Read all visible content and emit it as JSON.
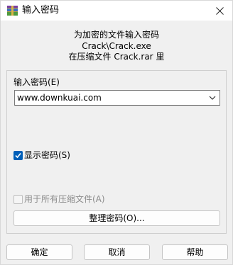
{
  "window": {
    "title": "输入密码"
  },
  "message": {
    "line1": "为加密的文件输入密码",
    "line2": "Crack\\Crack.exe",
    "line3": "在压缩文件 Crack.rar 里"
  },
  "password_section": {
    "label": "输入密码(E)",
    "value": "www.downkuai.com"
  },
  "options": {
    "show_password_label": "显示密码(S)",
    "show_password_checked": true,
    "all_archives_label": "用于所有压缩文件(A)",
    "all_archives_checked": false,
    "organize_button": "整理密码(O)..."
  },
  "buttons": {
    "ok": "确定",
    "cancel": "取消",
    "help": "帮助"
  }
}
